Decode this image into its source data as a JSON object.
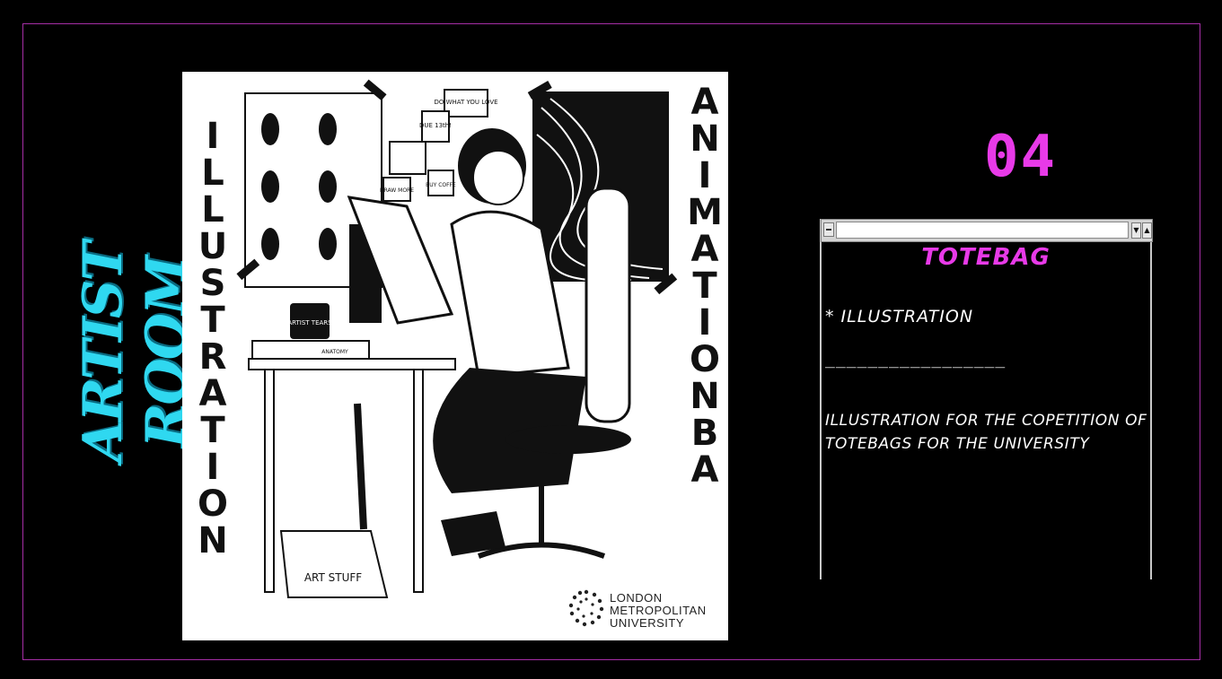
{
  "side_title": "ARTIST ROOM",
  "poster": {
    "left_text": "ILLUSTRATION",
    "right_text": "ANIMATION BA",
    "notes": [
      "DO WHAT YOU LOVE",
      "DUE 13th!",
      "DRAW MORE",
      "BUY COFFE"
    ],
    "mug_label": "ARTIST TEARS",
    "book_label": "ANATOMY",
    "box_label": "ART STUFF",
    "logo_lines": [
      "LONDON",
      "METROPOLITAN",
      "UNIVERSITY"
    ]
  },
  "number": "04",
  "window": {
    "title": "TOTEBAG",
    "item": "* ILLUSTRATION",
    "divider": "_________________",
    "description": "ILLUSTRATION FOR THE COPETITION OF TOTEBAGS FOR THE UNIVERSITY"
  },
  "colors": {
    "accent_pink": "#e83ae8",
    "accent_cyan": "#2fd8f0",
    "frame": "#a62ea6"
  }
}
